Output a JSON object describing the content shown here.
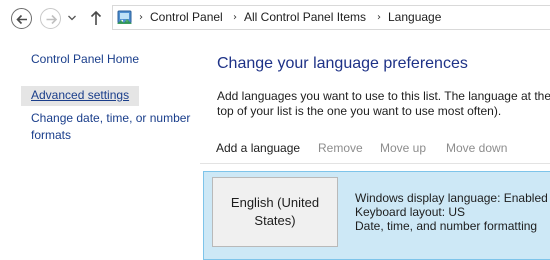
{
  "addressbar": {
    "breadcrumbs": [
      "Control Panel",
      "All Control Panel Items",
      "Language"
    ]
  },
  "sidebar": {
    "items": [
      {
        "label": "Control Panel Home"
      },
      {
        "label": "Advanced settings"
      },
      {
        "label": "Change date, time, or number formats"
      }
    ]
  },
  "main": {
    "title": "Change your language preferences",
    "description": "Add languages you want to use to this list. The language at the top of your list is the one you want to use most often).",
    "toolbar": {
      "add": "Add a language",
      "remove": "Remove",
      "move_up": "Move up",
      "move_down": "Move down"
    },
    "languages": [
      {
        "name": "English (United States)",
        "details": [
          "Windows display language: Enabled",
          "Keyboard layout: US",
          "Date, time, and number formatting"
        ]
      }
    ]
  },
  "colors": {
    "link": "#1a3e8b",
    "heading": "#1e3287",
    "selected_row": "#cde8f6",
    "disabled_text": "#8d8d8d"
  },
  "icons": [
    "back-arrow-icon",
    "forward-arrow-icon",
    "recent-locations-chevron-icon",
    "up-arrow-icon",
    "control-panel-icon",
    "breadcrumb-separator-icon"
  ]
}
